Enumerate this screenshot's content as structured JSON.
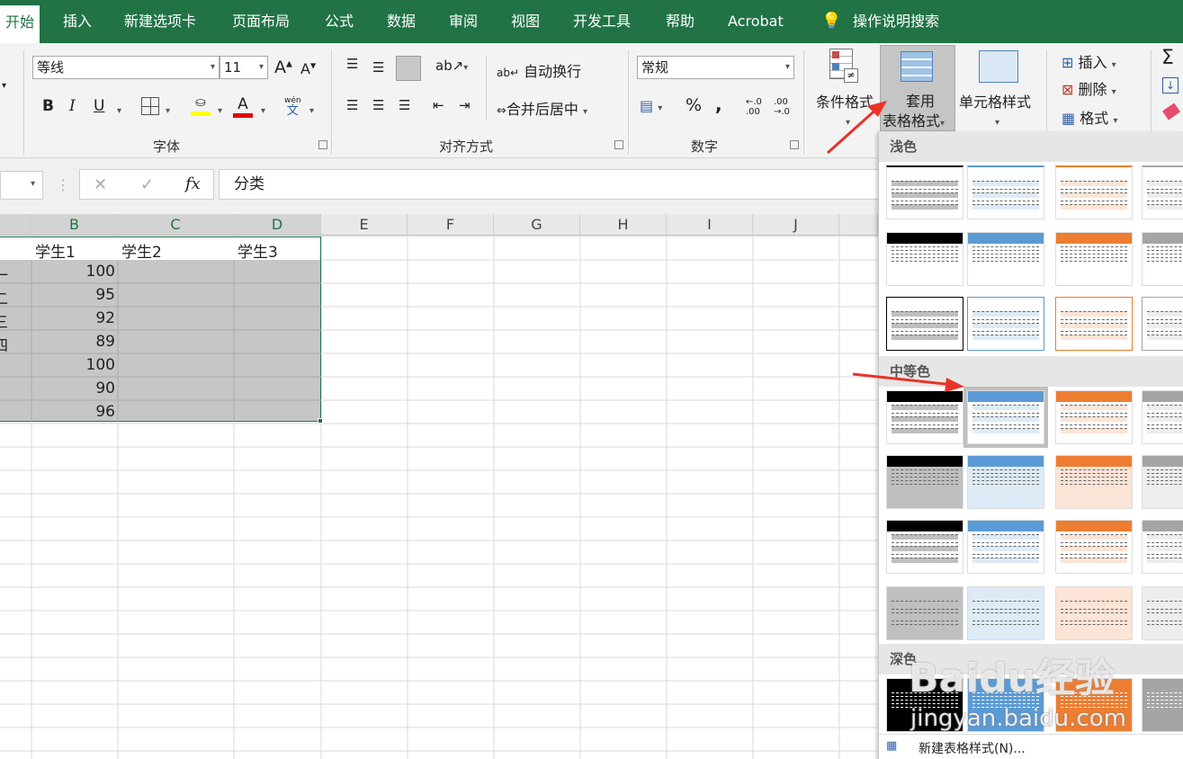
{
  "tabs": [
    {
      "label": "开始",
      "active": true
    },
    {
      "label": "插入"
    },
    {
      "label": "新建选项卡"
    },
    {
      "label": "页面布局"
    },
    {
      "label": "公式"
    },
    {
      "label": "数据"
    },
    {
      "label": "审阅"
    },
    {
      "label": "视图"
    },
    {
      "label": "开发工具"
    },
    {
      "label": "帮助"
    },
    {
      "label": "Acrobat"
    }
  ],
  "tell_me": "操作说明搜索",
  "font": {
    "name": "等线",
    "size": "11",
    "grow": "A",
    "shrink": "A",
    "bold": "B",
    "italic": "I",
    "underline": "U",
    "font_color": "A",
    "phonetic_top": "wén",
    "phonetic_bottom": "文",
    "group_label": "字体"
  },
  "alignment": {
    "wrap": "自动换行",
    "merge": "合并后居中",
    "group_label": "对齐方式"
  },
  "number": {
    "format": "常规",
    "percent": "%",
    "comma": ",",
    "dec_inc_top": "←.0",
    "dec_inc_bottom": ".00",
    "dec_dec_top": ".00",
    "dec_dec_bottom": "→.0",
    "group_label": "数字"
  },
  "styles": {
    "conditional": "条件格式",
    "table_format_1": "套用",
    "table_format_2": "表格格式",
    "cell_styles": "单元格样式"
  },
  "cells": {
    "insert": "插入",
    "delete": "删除",
    "format": "格式"
  },
  "editing": {
    "sum": "Σ"
  },
  "formula_bar": {
    "fx": "fx",
    "cancel": "✕",
    "enter": "✓",
    "content": "分类"
  },
  "grid": {
    "columns": [
      "B",
      "C",
      "D",
      "E",
      "F",
      "G",
      "H",
      "I",
      "J"
    ],
    "headers": [
      "学生1",
      "学生2",
      "学生3"
    ],
    "values": [
      "100",
      "95",
      "92",
      "89",
      "100",
      "90",
      "96"
    ],
    "left_marks": [
      "一",
      "二",
      "三",
      "四",
      "",
      "",
      ""
    ]
  },
  "gallery": {
    "light": "浅色",
    "medium": "中等色",
    "dark": "深色",
    "new_style": "新建表格样式(N)..."
  },
  "watermark": {
    "line1": "Baidu经验",
    "line2": "jingyan.baidu.com"
  },
  "colors": {
    "excel_green": "#217346",
    "blue": "#5b9bd5",
    "orange": "#ed7d31",
    "gray": "#a5a5a5",
    "dark": "#000000",
    "arrow_red": "#e8332a"
  }
}
